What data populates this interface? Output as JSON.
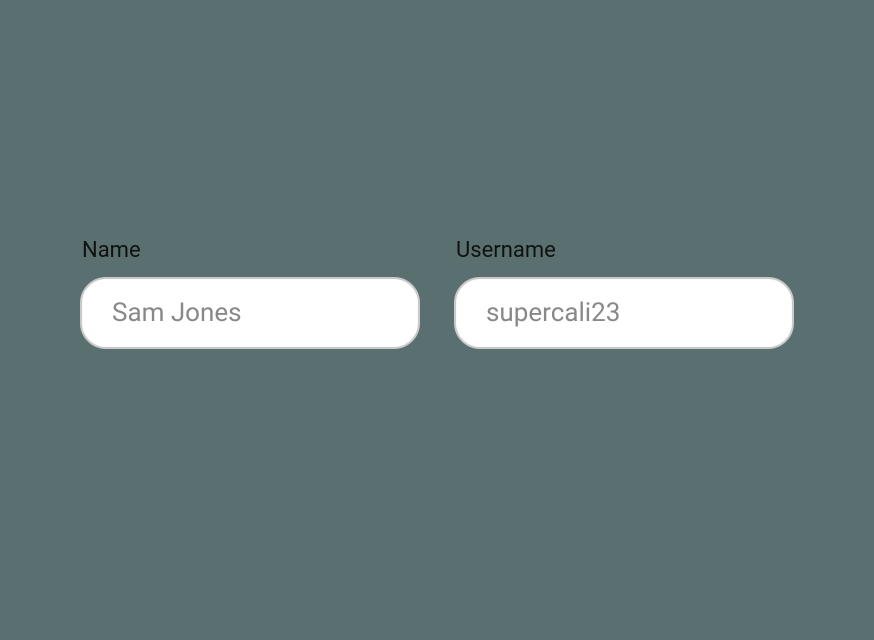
{
  "form": {
    "fields": [
      {
        "label": "Name",
        "placeholder": "Sam Jones",
        "value": ""
      },
      {
        "label": "Username",
        "placeholder": "supercali23",
        "value": ""
      }
    ]
  }
}
